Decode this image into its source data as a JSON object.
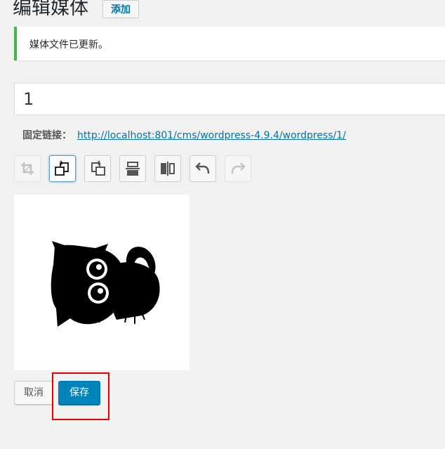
{
  "header": {
    "title": "编辑媒体",
    "add_label": "添加"
  },
  "notice": {
    "text": "媒体文件已更新。"
  },
  "title_field": {
    "value": "1"
  },
  "permalink": {
    "label": "固定链接：",
    "url": "http://localhost:801/cms/wordpress-4.9.4/wordpress/1/"
  },
  "toolbar": [
    {
      "icon": "crop-icon",
      "state": "disabled"
    },
    {
      "icon": "rotate-left-icon",
      "state": "active"
    },
    {
      "icon": "rotate-right-icon",
      "state": "normal"
    },
    {
      "icon": "flip-vertical-icon",
      "state": "normal"
    },
    {
      "icon": "flip-horizontal-icon",
      "state": "normal"
    },
    {
      "icon": "undo-icon",
      "state": "normal"
    },
    {
      "icon": "redo-icon",
      "state": "disabled"
    }
  ],
  "actions": {
    "cancel_label": "取消",
    "save_label": "保存"
  },
  "colors": {
    "notice_border": "#46b450",
    "primary": "#0085ba",
    "link": "#0073aa",
    "highlight": "#e10000"
  }
}
